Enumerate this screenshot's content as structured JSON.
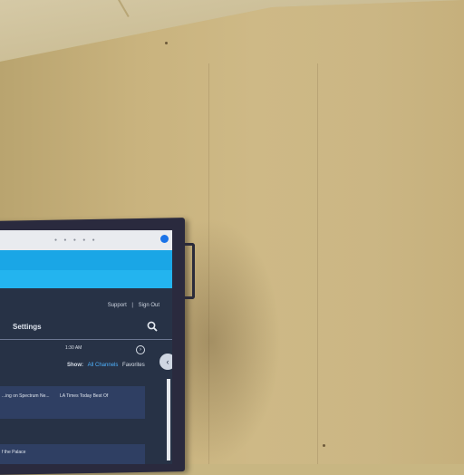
{
  "scene": {
    "description_colors": {
      "wall": "#c9b47f",
      "monitor_frame": "#2a2a3e",
      "site_header": "#1aa6e6",
      "screen_bg": "#273246",
      "link_accent": "#4fb3ff"
    }
  },
  "screen": {
    "top_links": {
      "support": "Support",
      "separator": "|",
      "sign_out": "Sign Out"
    },
    "nav": {
      "settings": "Settings"
    },
    "time_text": "1:30 AM",
    "show_row": {
      "label": "Show:",
      "all_channels": "All Channels",
      "favorites": "Favorites"
    },
    "listing_row": {
      "col1": "...ing on Spectrum Ne...",
      "col2": "LA Times Today Best Of"
    },
    "lower_row": {
      "col1": "f the Palace"
    },
    "icons": {
      "search": "search-icon",
      "next": "chevron-right-icon",
      "side": "chevron-left-icon",
      "extension": "extension-icon"
    }
  }
}
